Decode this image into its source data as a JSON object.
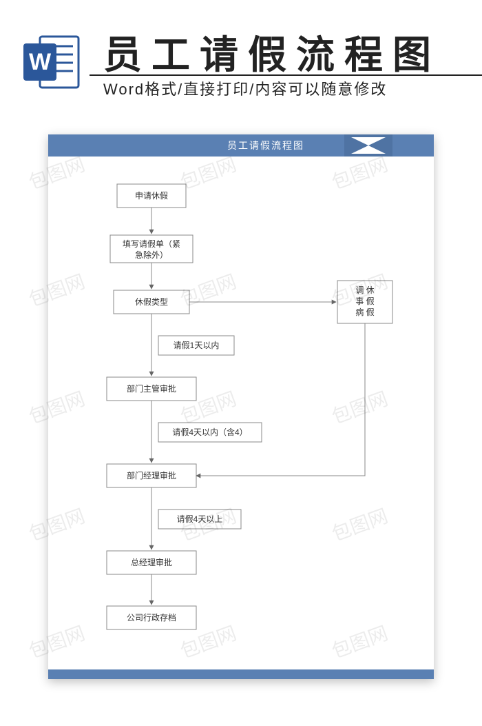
{
  "banner": {
    "title": "员工请假流程图",
    "subtitle": "Word格式/直接打印/内容可以随意修改"
  },
  "doc": {
    "headerTitle": "员工请假流程图"
  },
  "flow": {
    "n1": "申请休假",
    "n2": "填写请假单（紧急除外）",
    "n3": "休假类型",
    "n4": "调 休\n事 假\n病 假",
    "c1": "请假1天以内",
    "n5": "部门主管审批",
    "c2": "请假4天以内（含4）",
    "n6": "部门经理审批",
    "c3": "请假4天以上",
    "n7": "总经理审批",
    "n8": "公司行政存档"
  },
  "watermark": "包图网"
}
